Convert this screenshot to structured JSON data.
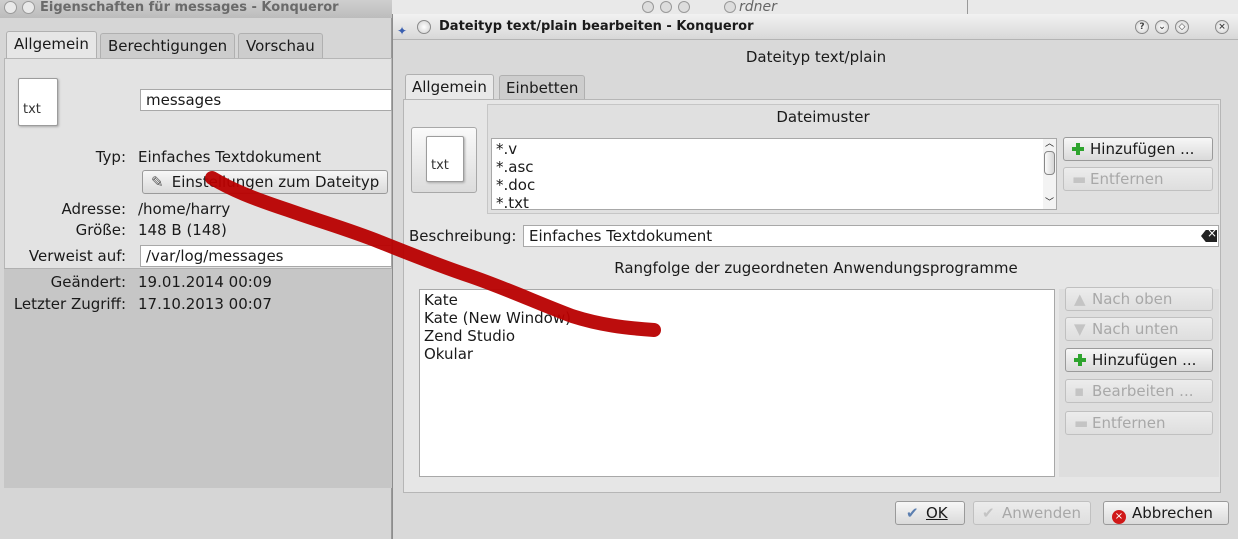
{
  "left_window": {
    "title": "Eigenschaften für messages - Konqueror",
    "tabs": [
      "Allgemein",
      "Berechtigungen",
      "Vorschau"
    ],
    "icon_label": "txt",
    "name_value": "messages",
    "type_label": "Typ:",
    "type_value": "Einfaches Textdokument",
    "settings_button": "Einstellungen zum Dateityp",
    "address_label": "Adresse:",
    "address_value": "/home/harry",
    "size_label": "Größe:",
    "size_value": "148 B (148)",
    "link_label": "Verweist auf:",
    "link_value": "/var/log/messages",
    "modified_label": "Geändert:",
    "modified_value": "19.01.2014 00:09",
    "accessed_label": "Letzter Zugriff:",
    "accessed_value": "17.10.2013 00:07"
  },
  "background_window": {
    "title_fragment": "rdner"
  },
  "dialog": {
    "title": "Dateityp text/plain bearbeiten - Konqueror",
    "heading": "Dateityp text/plain",
    "tabs": [
      "Allgemein",
      "Einbetten"
    ],
    "icon_label": "txt",
    "patterns_heading": "Dateimuster",
    "patterns": [
      "*.v",
      "*.asc",
      "*.doc",
      "*.txt"
    ],
    "add_button": "Hinzufügen ...",
    "remove_button": "Entfernen",
    "description_label": "Beschreibung:",
    "description_value": "Einfaches Textdokument",
    "apps_heading": "Rangfolge der zugeordneten Anwendungsprogramme",
    "apps": [
      "Kate",
      "Kate (New Window)",
      "Zend Studio",
      "Okular"
    ],
    "move_up_button": "Nach oben",
    "move_down_button": "Nach unten",
    "apps_add_button": "Hinzufügen ...",
    "edit_button": "Bearbeiten ...",
    "apps_remove_button": "Entfernen",
    "ok_button": "OK",
    "apply_button": "Anwenden",
    "cancel_button": "Abbrechen"
  },
  "colors": {
    "annotation_stroke": "#b80000",
    "add_icon": "#2ea42e",
    "cancel_icon": "#d01818"
  }
}
